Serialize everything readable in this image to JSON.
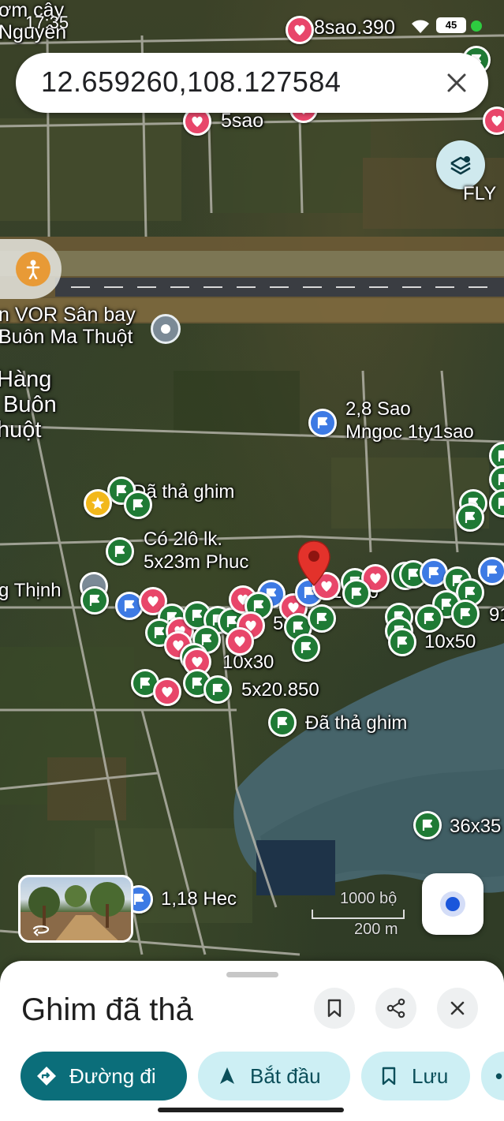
{
  "status_bar": {
    "time": "17:35",
    "battery": "45"
  },
  "search": {
    "query": "12.659260,108.127584"
  },
  "map": {
    "layers_button_label": "FLY",
    "labels": [
      {
        "text": "ơm cây\nNguyên"
      },
      {
        "text": "8sao.390"
      },
      {
        "text": "5sao"
      },
      {
        "text": "n VOR Sân bay\nBuôn Ma Thuột"
      },
      {
        "text": "Hàng\n Buôn\nhuột"
      },
      {
        "text": "2,8 Sao\nMngoc 1ty1sao"
      },
      {
        "text": "Đã thả ghim"
      },
      {
        "text": "Có 2lô lk.\n5x23m Phuc"
      },
      {
        "text": "g Thịnh"
      },
      {
        "text": "1...50"
      },
      {
        "text": "5...0"
      },
      {
        "text": "91"
      },
      {
        "text": "10x50"
      },
      {
        "text": "10x30"
      },
      {
        "text": "5x20.850"
      },
      {
        "text": "Đã thả ghim"
      },
      {
        "text": "36x35"
      },
      {
        "text": "1,18 Hec"
      }
    ],
    "scale": {
      "top": "1000 bộ",
      "bottom": "200 m"
    }
  },
  "sheet": {
    "title": "Ghim đã thả",
    "chips": {
      "directions": "Đường đi",
      "start": "Bắt đầu",
      "save": "Lưu"
    }
  }
}
